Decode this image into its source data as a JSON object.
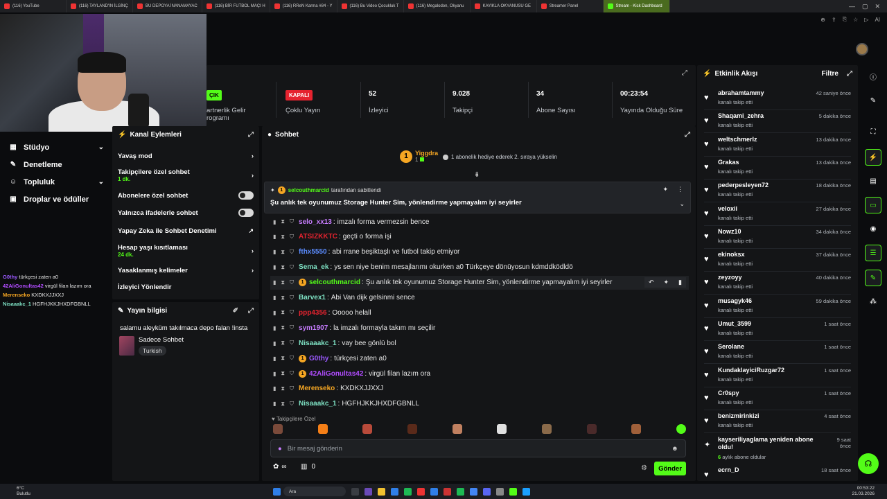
{
  "browser": {
    "tabs": [
      {
        "label": "(116) YouTube",
        "active": false
      },
      {
        "label": "(116) TAYLAND'IN İLGİNÇ",
        "active": false
      },
      {
        "label": "BU DEPOYA İNANAMAYAC",
        "active": false
      },
      {
        "label": "(116) BİR FUTBOL MAÇI H",
        "active": false
      },
      {
        "label": "(116) RReN Karma #84 - Y",
        "active": false
      },
      {
        "label": "(116) Bu Video Çocukluk T",
        "active": false
      },
      {
        "label": "(116) Megalodon, Okyanu",
        "active": false
      },
      {
        "label": "KAYIKLA OKYANUSU GE",
        "active": false
      },
      {
        "label": "Streamer Panel",
        "active": false
      },
      {
        "label": "Stream - Kick Dashboard",
        "active": true
      }
    ],
    "ai_label": "AI"
  },
  "sidebar": {
    "items": [
      {
        "label": "Stüdyo",
        "icon": "grid-icon",
        "chevron": true
      },
      {
        "label": "Denetleme",
        "icon": "wrench-icon",
        "chevron": false
      },
      {
        "label": "Topluluk",
        "icon": "people-icon",
        "chevron": true
      },
      {
        "label": "Droplar ve ödüller",
        "icon": "gift-icon",
        "chevron": false
      }
    ]
  },
  "overlay_chat": [
    {
      "user": "G0thy",
      "text": "türkçesi zaten a0",
      "color": "#9b59ff"
    },
    {
      "user": "42AliGonultas42",
      "text": "virgül filan lazım ora",
      "color": "#b14cff"
    },
    {
      "user": "Merenseko",
      "text": "KXDKXJJXXJ",
      "color": "#f5a623"
    },
    {
      "user": "Nisaaakc_1",
      "text": "HGFHJKKJHXDFGBNLL",
      "color": "#7fe3c5"
    }
  ],
  "stats": {
    "partner": {
      "badge": "ÇIK",
      "label_line1": "artnerlik Gelir",
      "label_line2": "rogramı"
    },
    "multi": {
      "badge": "KAPALI",
      "label": "Çoklu Yayın"
    },
    "viewers": {
      "value": "52",
      "label": "İzleyici"
    },
    "followers": {
      "value": "9.028",
      "label": "Takipçi"
    },
    "subs": {
      "value": "34",
      "label": "Abone Sayısı"
    },
    "uptime": {
      "value": "00:23:54",
      "label": "Yayında Olduğu Süre"
    }
  },
  "actions": {
    "title": "Kanal Eylemleri",
    "items": [
      {
        "label": "Yavaş mod",
        "sub": "",
        "control": "chevron"
      },
      {
        "label": "Takipçilere özel sohbet",
        "sub": "1 dk.",
        "control": "chevron"
      },
      {
        "label": "Abonelere özel sohbet",
        "sub": "",
        "control": "toggle"
      },
      {
        "label": "Yalnızca ifadelerle sohbet",
        "sub": "",
        "control": "toggle"
      },
      {
        "label": "Yapay Zeka ile Sohbet Denetimi",
        "sub": "",
        "control": "external"
      },
      {
        "label": "Hesap yaşı kısıtlaması",
        "sub": "24 dk.",
        "control": "chevron"
      },
      {
        "label": "Yasaklanmış kelimeler",
        "sub": "",
        "control": "chevron"
      },
      {
        "label": "İzleyici Yönlendir",
        "sub": "",
        "control": "none"
      }
    ]
  },
  "stream_info": {
    "title": "Yayın bilgisi",
    "stream_title": "salamu aleyküm takılmaca depo falan !insta",
    "category": "Sadece Sohbet",
    "language": "Turkish"
  },
  "chat": {
    "title": "Sohbet",
    "top_gifter": {
      "name": "Yiggdra",
      "rank": "1",
      "count": "1"
    },
    "gift_prompt": "1 abonelik hediye ederek 2. sıraya yükselin",
    "pinned": {
      "by": "selcouthmarcid",
      "by_suffix": "tarafından sabitlendi",
      "text": "Şu anlık tek oyunumuz Storage Hunter Sim, yönlendirme yapmayalım iyi seyirler"
    },
    "messages": [
      {
        "user": "selo_xx13",
        "text": "imzalı forma vermezsin bence",
        "color": "#c77dff",
        "coin": false
      },
      {
        "user": "ATSIZKKTC",
        "text": "geçti o forma işi",
        "color": "#e5232f",
        "coin": false
      },
      {
        "user": "fthx5550",
        "text": "abi rrane beşiktaşlı ve futbol takip etmiyor",
        "color": "#5b8cff",
        "coin": false
      },
      {
        "user": "Sema_ek",
        "text": "ys sen niye benim mesajlarımı okurken a0 Türkçeye dönüyosun kdmddködldö",
        "color": "#7fe3c5",
        "coin": false
      },
      {
        "user": "selcouthmarcid",
        "text": "Şu anlık tek oyunumuz Storage Hunter Sim, yönlendirme yapmayalım iyi seyirler",
        "color": "#53fc18",
        "coin": true
      },
      {
        "user": "Barvex1",
        "text": "Abi Van dijk gelsinmi sence",
        "color": "#7fe3c5",
        "coin": false
      },
      {
        "user": "ppp4356",
        "text": "Ooooo helall",
        "color": "#e5232f",
        "coin": false
      },
      {
        "user": "sym1907",
        "text": "la imzalı formayla takım mı seçilir",
        "color": "#c77dff",
        "coin": false
      },
      {
        "user": "Nisaaakc_1",
        "text": "vay bee gönlü bol",
        "color": "#7fe3c5",
        "coin": false
      },
      {
        "user": "G0thy",
        "text": "türkçesi zaten a0",
        "color": "#9b59ff",
        "coin": true
      },
      {
        "user": "42AliGonultas42",
        "text": "virgül filan lazım ora",
        "color": "#b14cff",
        "coin": true
      },
      {
        "user": "Merenseko",
        "text": "KXDKXJJXXJ",
        "color": "#f5a623",
        "coin": false
      },
      {
        "user": "Nisaaakc_1",
        "text": "HGFHJKKJHXDFGBNLL",
        "color": "#7fe3c5",
        "coin": false
      }
    ],
    "followers_only_label": "Takipçilere Özel",
    "input_placeholder": "Bir mesaj gönderin",
    "points": "∞",
    "chest_count": "0",
    "send_label": "Gönder"
  },
  "feed": {
    "title": "Etkinlik Akışı",
    "filter_label": "Filtre",
    "items": [
      {
        "name": "abrahamtammy",
        "action": "kanalı takip etti",
        "time": "42 saniye önce"
      },
      {
        "name": "Shaqami_zehra",
        "action": "kanalı takip etti",
        "time": "5 dakika önce"
      },
      {
        "name": "weltschmerlz",
        "action": "kanalı takip etti",
        "time": "13 dakika önce"
      },
      {
        "name": "Grakas",
        "action": "kanalı takip etti",
        "time": "13 dakika önce"
      },
      {
        "name": "pederpesleyen72",
        "action": "kanalı takip etti",
        "time": "18 dakika önce"
      },
      {
        "name": "veloxii",
        "action": "kanalı takip etti",
        "time": "27 dakika önce"
      },
      {
        "name": "Nowz10",
        "action": "kanalı takip etti",
        "time": "34 dakika önce"
      },
      {
        "name": "ekinoksx",
        "action": "kanalı takip etti",
        "time": "37 dakika önce"
      },
      {
        "name": "zeyzoyy",
        "action": "kanalı takip etti",
        "time": "40 dakika önce"
      },
      {
        "name": "musagyk46",
        "action": "kanalı takip etti",
        "time": "59 dakika önce"
      },
      {
        "name": "Umut_3599",
        "action": "kanalı takip etti",
        "time": "1 saat önce"
      },
      {
        "name": "Serolane",
        "action": "kanalı takip etti",
        "time": "1 saat önce"
      },
      {
        "name": "KundaklayiciRuzgar72",
        "action": "kanalı takip etti",
        "time": "1 saat önce"
      },
      {
        "name": "Cr0spy",
        "action": "kanalı takip etti",
        "time": "1 saat önce"
      },
      {
        "name": "benizmirinkizi",
        "action": "kanalı takip etti",
        "time": "4 saat önce"
      }
    ],
    "sub_event": {
      "name": "kayseriliyaglama yeniden abone oldu!",
      "months": "6",
      "months_label": "aylık abone oldular",
      "time_line1": "9 saat",
      "time_line2": "önce"
    },
    "last_item": {
      "name": "ecrn_D",
      "time": "18 saat önce"
    }
  },
  "taskbar": {
    "weather_temp": "6°C",
    "weather_text": "Bulutlu",
    "search": "Ara",
    "time": "00:53:22",
    "date": "21.03.2026"
  },
  "colors": {
    "accent": "#53fc18",
    "panel": "#141517",
    "bg": "#0b0c0e",
    "danger": "#e5232f"
  }
}
